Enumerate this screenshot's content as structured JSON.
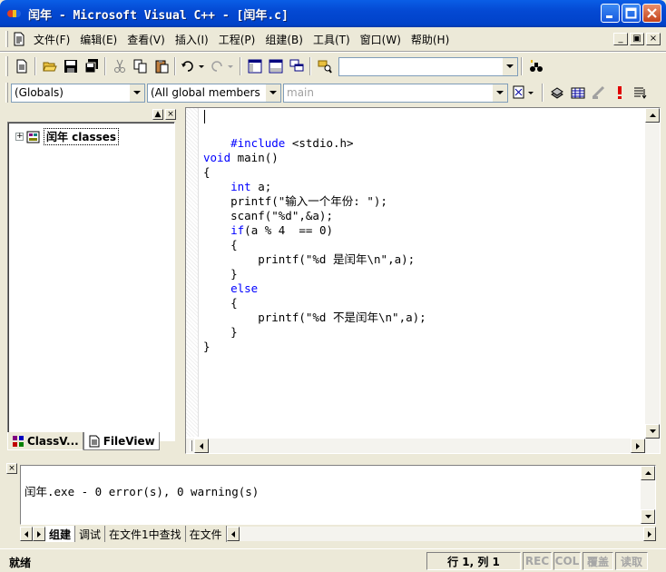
{
  "window": {
    "title": "闰年 - Microsoft Visual C++ - [闰年.c]"
  },
  "menu": [
    "文件(F)",
    "编辑(E)",
    "查看(V)",
    "插入(I)",
    "工程(P)",
    "组建(B)",
    "工具(T)",
    "窗口(W)",
    "帮助(H)"
  ],
  "toolbar": {
    "find_value": ""
  },
  "wizard_bar": {
    "scope": "(Globals)",
    "members": "(All global members",
    "function": "main"
  },
  "workspace": {
    "tree_root": "闰年 classes",
    "tabs": [
      "ClassV...",
      "FileView"
    ]
  },
  "editor": {
    "lines": [
      "    #include <stdio.h>",
      "void main()",
      "{",
      "    int a;",
      "    printf(\"输入一个年份: \");",
      "    scanf(\"%d\",&a);",
      "    if(a % 4  == 0)",
      "    {",
      "        printf(\"%d 是闰年\\n\",a);",
      "    }",
      "    else",
      "    {",
      "        printf(\"%d 不是闰年\\n\",a);",
      "    }",
      "}"
    ]
  },
  "output": {
    "text": "闰年.exe - 0 error(s), 0 warning(s)",
    "tabs": [
      "组建",
      "调试",
      "在文件1中查找",
      "在文件"
    ]
  },
  "status": {
    "ready": "就绪",
    "position": "行 1, 列 1",
    "rec": "REC",
    "col": "COL",
    "ovr": "覆盖",
    "read": "读取"
  },
  "colors": {
    "keyword": "#0000ff",
    "titlebar": "#0449d3",
    "chrome": "#ece9d8"
  }
}
